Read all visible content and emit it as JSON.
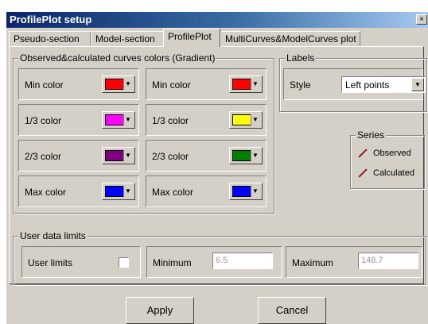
{
  "window": {
    "title": "ProfilePlot setup",
    "close_glyph": "×"
  },
  "tabs": [
    {
      "label": "Pseudo-section"
    },
    {
      "label": "Model-section"
    },
    {
      "label": "ProfilePlot"
    },
    {
      "label": "MultiCurves&ModelCurves plot"
    }
  ],
  "gradient_group": {
    "label": "Observed&calculated curves colors (Gradient)",
    "left": [
      {
        "label": "Min color",
        "color": "#ff0000"
      },
      {
        "label": "1/3 color",
        "color": "#ff00ff"
      },
      {
        "label": "2/3 color",
        "color": "#800080"
      },
      {
        "label": "Max color",
        "color": "#0000ff"
      }
    ],
    "right": [
      {
        "label": "Min color",
        "color": "#ff0000"
      },
      {
        "label": "1/3 color",
        "color": "#ffff00"
      },
      {
        "label": "2/3 color",
        "color": "#008000"
      },
      {
        "label": "Max color",
        "color": "#0000ff"
      }
    ]
  },
  "labels_group": {
    "label": "Labels",
    "style_label": "Style",
    "style_value": "Left points"
  },
  "series_group": {
    "label": "Series",
    "items": [
      {
        "label": "Observed"
      },
      {
        "label": "Calculated"
      }
    ]
  },
  "limits_group": {
    "label": "User data limits",
    "user_limits_label": "User limits",
    "user_limits_checked": false,
    "minimum_label": "Minimum",
    "minimum_value": "6.5",
    "maximum_label": "Maximum",
    "maximum_value": "148.7"
  },
  "buttons": {
    "apply": "Apply",
    "cancel": "Cancel"
  }
}
